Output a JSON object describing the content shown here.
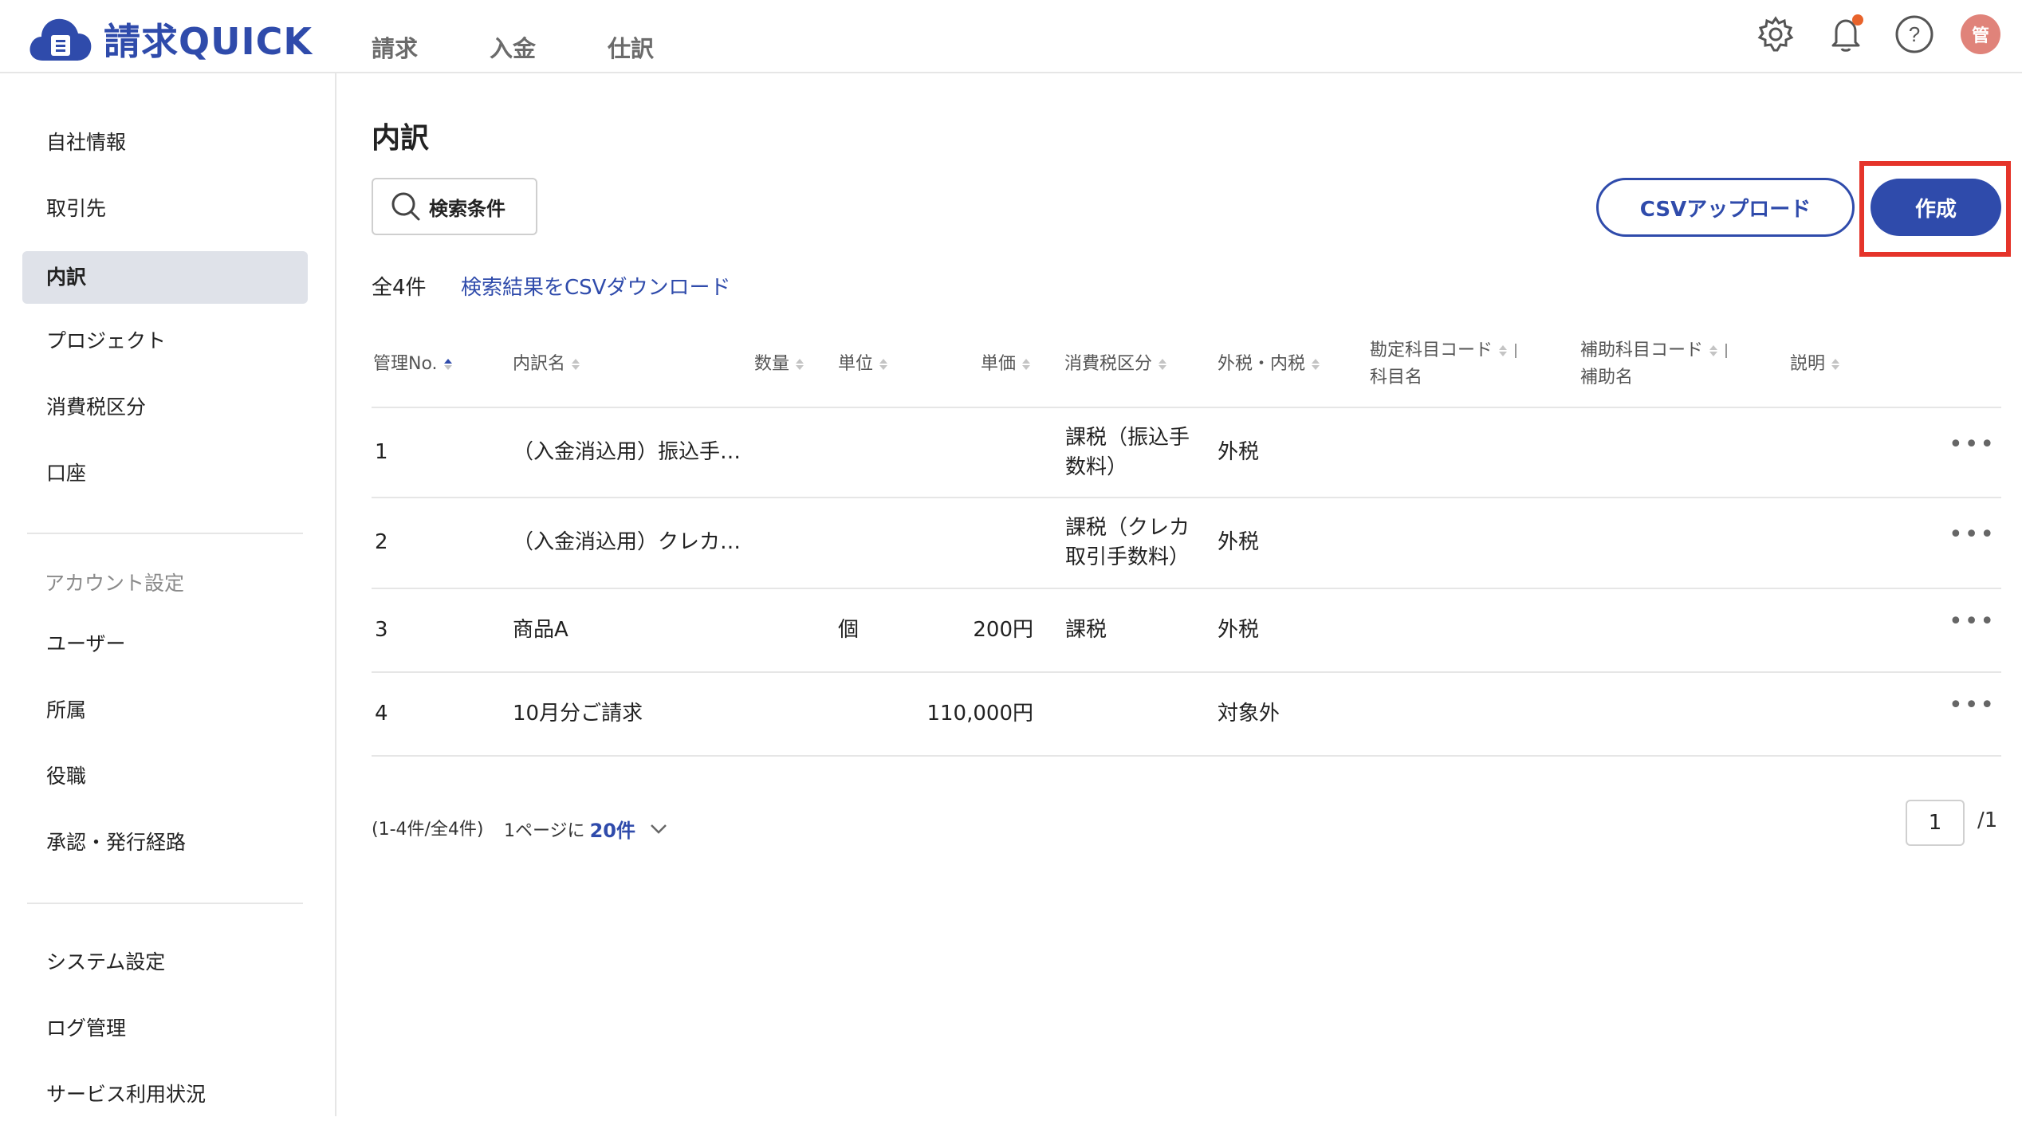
{
  "app": {
    "name": "請求QUICK",
    "avatar_text": "管"
  },
  "topnav": [
    "請求",
    "入金",
    "仕訳"
  ],
  "sidebar": {
    "items_main": [
      "自社情報",
      "取引先",
      "内訳",
      "プロジェクト",
      "消費税区分",
      "口座"
    ],
    "active_item": "内訳",
    "account_heading": "アカウント設定",
    "items_account": [
      "ユーザー",
      "所属",
      "役職",
      "承認・発行経路"
    ],
    "items_system": [
      "システム設定",
      "ログ管理",
      "サービス利用状況"
    ]
  },
  "main": {
    "title": "内訳",
    "search_label": "検索条件",
    "csv_upload_label": "CSVアップロード",
    "create_label": "作成",
    "count_text": "全4件",
    "csv_download_label": "検索結果をCSVダウンロード"
  },
  "table": {
    "headers": {
      "no": "管理No.",
      "name": "内訳名",
      "qty": "数量",
      "unit": "単位",
      "price": "単価",
      "tax_class": "消費税区分",
      "tax_type": "外税・内税",
      "account_code": "勘定科目コード",
      "account_name": "科目名",
      "sub_code": "補助科目コード",
      "sub_name": "補助名",
      "desc": "説明"
    },
    "rows": [
      {
        "no": "1",
        "name": "（入金消込用）振込手…",
        "qty": "",
        "unit": "",
        "price": "",
        "tax_class_1": "課税（振込手",
        "tax_class_2": "数料）",
        "tax_type": "外税"
      },
      {
        "no": "2",
        "name": "（入金消込用）クレカ…",
        "qty": "",
        "unit": "",
        "price": "",
        "tax_class_1": "課税（クレカ",
        "tax_class_2": "取引手数料）",
        "tax_type": "外税"
      },
      {
        "no": "3",
        "name": "商品A",
        "qty": "",
        "unit": "個",
        "price": "200円",
        "tax_class_1": "課税",
        "tax_class_2": "",
        "tax_type": "外税"
      },
      {
        "no": "4",
        "name": "10月分ご請求",
        "qty": "",
        "unit": "",
        "price": "110,000円",
        "tax_class_1": "",
        "tax_class_2": "",
        "tax_type": "対象外"
      }
    ],
    "row_menu": "•••"
  },
  "pagination": {
    "range_text": "(1-4件/全4件)",
    "per_page_prefix": "1ページに",
    "per_page_value": "20件",
    "current_page": "1",
    "total_pages": "/1"
  },
  "colors": {
    "accent": "#2f4bab",
    "highlight": "#e5342a",
    "notification": "#e8632b"
  },
  "icons": [
    "gear-icon",
    "bell-icon",
    "help-icon",
    "search-icon",
    "chevron-down-icon",
    "more-icon"
  ]
}
